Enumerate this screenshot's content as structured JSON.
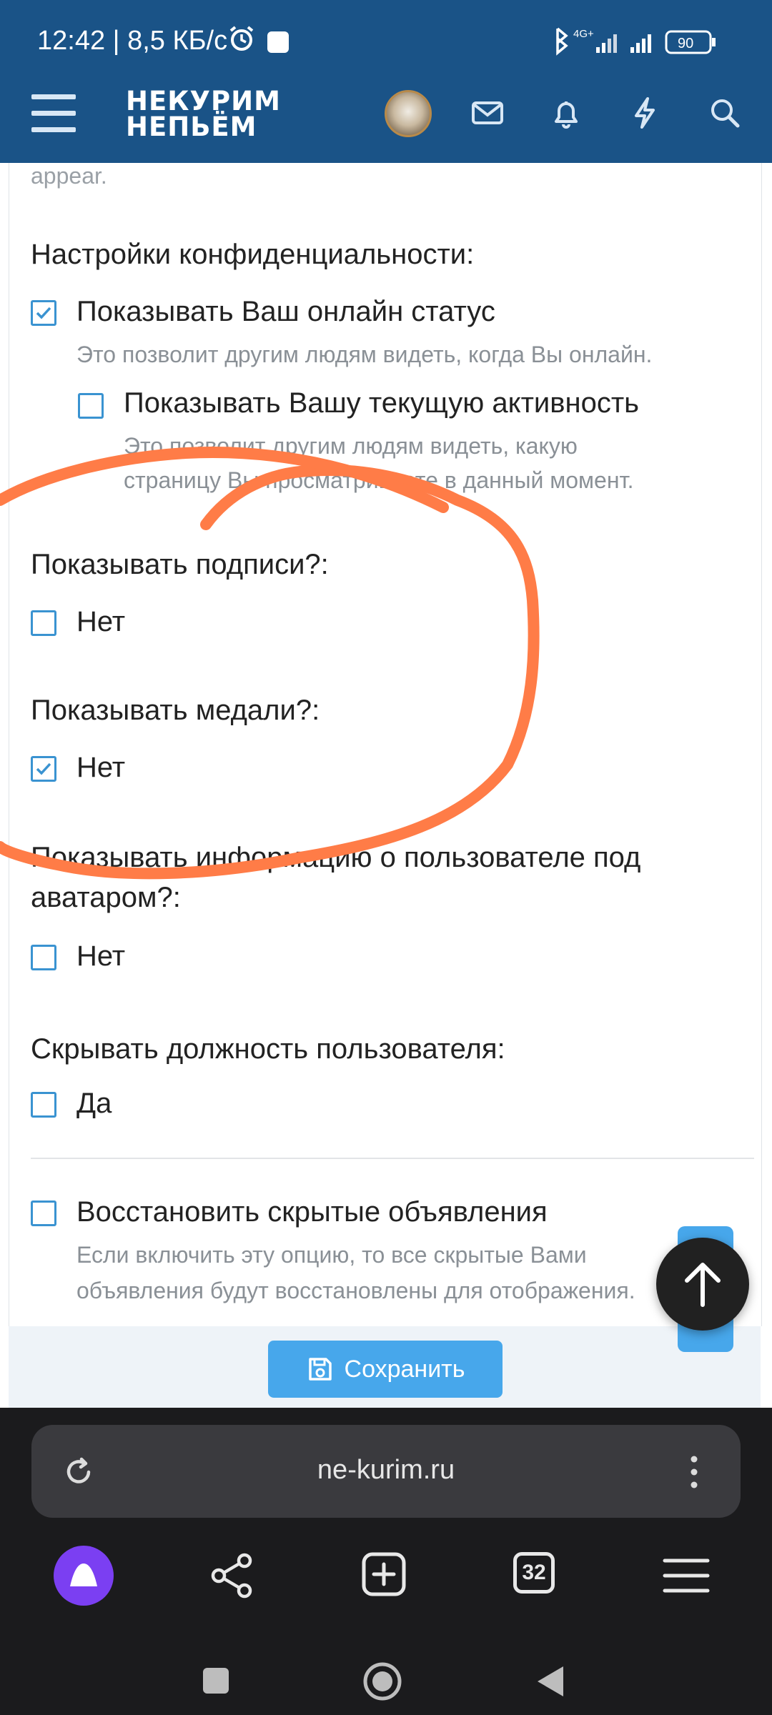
{
  "status_bar": {
    "time": "12:42 | 8,5 КБ/с",
    "network": "4G+",
    "battery": "90"
  },
  "header": {
    "logo_line1": "НЕКУРИМ",
    "logo_line2": "НЕПЬЁМ",
    "icons": [
      "menu-icon",
      "avatar",
      "mail-icon",
      "bell-icon",
      "bolt-icon",
      "search-icon"
    ]
  },
  "settings": {
    "faded_text": "appear.",
    "privacy_label": "Настройки конфиденциальности:",
    "online_status": {
      "label": "Показывать Ваш онлайн статус",
      "hint": "Это позволит другим людям видеть, когда Вы онлайн.",
      "checked": true
    },
    "activity": {
      "label": "Показывать Вашу текущую активность",
      "hint1": "Это позволит другим людям видеть, какую",
      "hint2": "страницу Вы просматриваете в данный момент.",
      "checked": false
    },
    "signatures": {
      "section": "Показывать подписи?:",
      "label": "Нет",
      "checked": false
    },
    "medals": {
      "section": "Показывать медали?:",
      "label": "Нет",
      "checked": true
    },
    "user_info": {
      "section_line1": "Показывать информацию о пользователе под",
      "section_line2": "аватаром?:",
      "label": "Нет",
      "checked": false
    },
    "hide_title": {
      "section": "Скрывать должность пользователя:",
      "label": "Да",
      "checked": false
    },
    "restore_notices": {
      "label": "Восстановить скрытые объявления",
      "hint1": "Если включить эту опцию, то все скрытые Вами",
      "hint2": "объявления будут восстановлены для отображения.",
      "checked": false
    },
    "save_button": "Сохранить"
  },
  "browser": {
    "url": "ne-kurim.ru",
    "tab_count": "32"
  },
  "colors": {
    "header_bg": "#1a5387",
    "checkbox": "#3a93d1",
    "save_button": "#47a7eb",
    "annotation": "#ff7c47"
  }
}
